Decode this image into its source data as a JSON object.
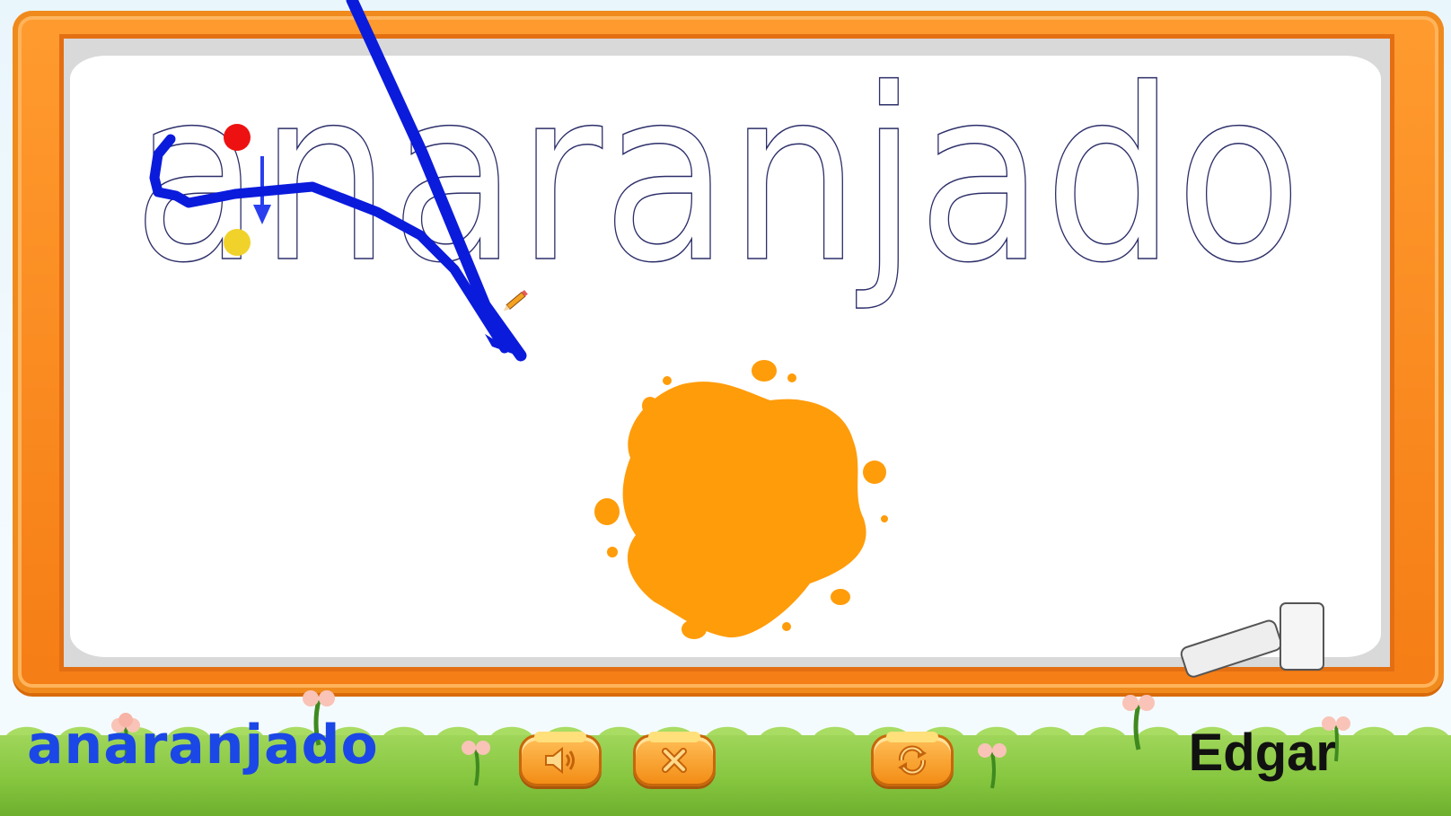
{
  "game": {
    "word": "anaranjado",
    "bottom_word": "anaranjado",
    "player_name": "Edgar"
  },
  "colors": {
    "frame": "#f57d15",
    "trace_stroke": "#0b1bdc",
    "blob": "#ff9c0a",
    "start_dot": "#ee1111",
    "end_dot": "#f0d22a",
    "bottom_word": "#1b47e6"
  },
  "buttons": {
    "sound_icon": "speaker-icon",
    "close_icon": "x-icon",
    "reset_icon": "refresh-icon"
  }
}
